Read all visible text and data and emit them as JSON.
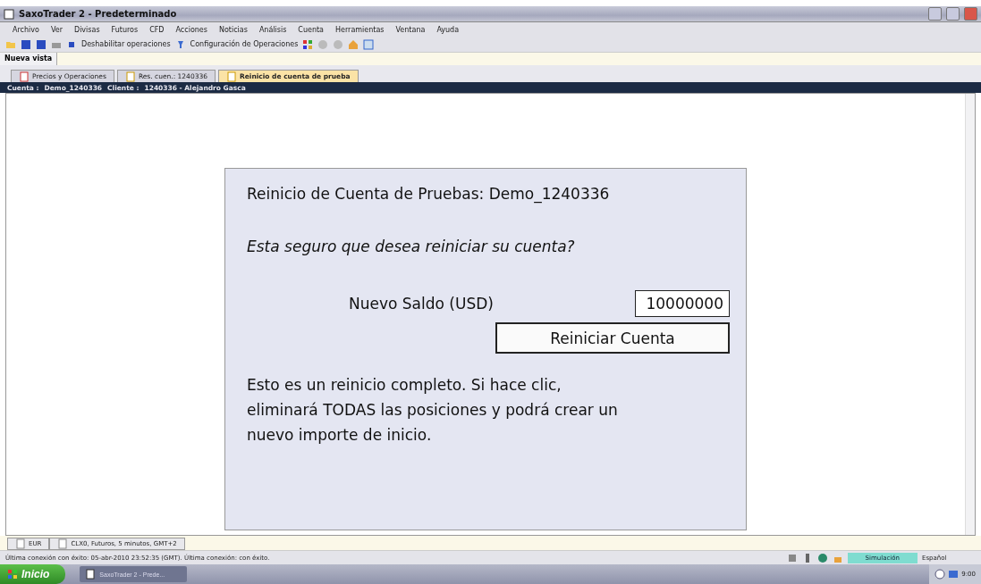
{
  "window": {
    "title": "SaxoTrader 2 - Predeterminado"
  },
  "menu": [
    "Archivo",
    "Ver",
    "Divisas",
    "Futuros",
    "CFD",
    "Acciones",
    "Noticias",
    "Análisis",
    "Cuenta",
    "Herramientas",
    "Ventana",
    "Ayuda"
  ],
  "toolbar": {
    "disable_label": "Deshabilitar operaciones",
    "config_label": "Configuración de Operaciones"
  },
  "view_tabs": [
    {
      "label": "Nueva vista",
      "selected": true
    }
  ],
  "doc_tabs": [
    {
      "label": "Precios y Operaciones",
      "selected": false
    },
    {
      "label": "Res. cuen.: 1240336",
      "selected": false
    },
    {
      "label": "Reinicio de cuenta de prueba",
      "selected": true
    }
  ],
  "account_bar": {
    "account_label": "Cuenta :",
    "account": "Demo_1240336",
    "client_label": "Cliente :",
    "client": "1240336 - Alejandro Gasca"
  },
  "dialog": {
    "title": "Reinicio de Cuenta de Pruebas: Demo_1240336",
    "question": "Esta seguro que desea reiniciar su cuenta?",
    "balance_label": "Nuevo Saldo (USD)",
    "balance_value": "10000000",
    "button": "Reiniciar Cuenta",
    "note": "Esto es un reinicio completo. Si hace clic, eliminará TODAS las posiciones y podrá crear un nuevo importe de inicio."
  },
  "bottom_tabs": [
    {
      "label": "EUR"
    },
    {
      "label": "CLX0, Futuros, 5 minutos, GMT+2"
    }
  ],
  "status_bar": {
    "message": "Última conexión con éxito: 05-abr-2010 23:52:35 (GMT). Última conexión: con éxito.",
    "mode": "Simulación",
    "language": "Español"
  },
  "taskbar": {
    "start": "Inicio",
    "task": "SaxoTrader 2 - Prede...",
    "clock": "9:00"
  }
}
